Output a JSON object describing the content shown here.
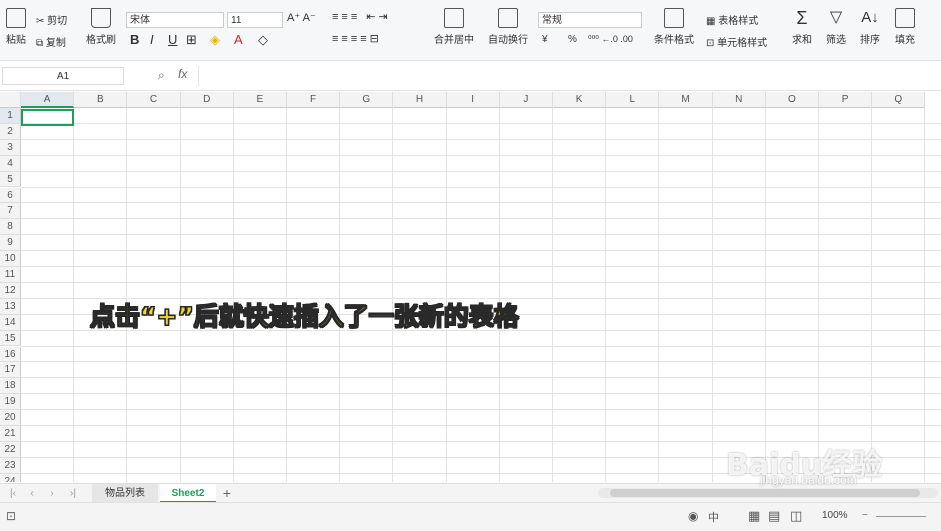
{
  "toolbar": {
    "paste": "粘贴",
    "cut": "剪切",
    "copy": "复制",
    "format_painter": "格式刷",
    "font_name": "宋体",
    "font_size": "11",
    "bold": "B",
    "italic": "I",
    "underline": "U",
    "merge_center": "合并居中",
    "wrap_text": "自动换行",
    "number_format": "常规",
    "currency": "¥",
    "percent": "%",
    "conditional_format": "条件格式",
    "table_style": "表格样式",
    "cell_style": "单元格样式",
    "sum": "求和",
    "filter": "筛选",
    "sort": "排序",
    "fill": "填充"
  },
  "formula_bar": {
    "cell_ref": "A1",
    "fx": "fx",
    "value": ""
  },
  "sheet": {
    "columns": [
      "A",
      "B",
      "C",
      "D",
      "E",
      "F",
      "G",
      "H",
      "I",
      "J",
      "K",
      "L",
      "M",
      "N",
      "O",
      "P",
      "Q"
    ],
    "rows": [
      "1",
      "2",
      "3",
      "4",
      "5",
      "6",
      "7",
      "8",
      "9",
      "10",
      "11",
      "12",
      "13",
      "14",
      "15",
      "16",
      "17",
      "18",
      "19",
      "20",
      "21",
      "22",
      "23",
      "24"
    ],
    "selected_cell": "A1"
  },
  "caption": "点击“+”后就快速插入了一张新的表格",
  "tabs": {
    "sheet1": "物品列表",
    "sheet2": "Sheet2",
    "add": "+"
  },
  "status": {
    "zoom": "100%",
    "input_mode": "中"
  },
  "watermark": {
    "brand": "Baidu经验",
    "url": "jingyan.baidu.com"
  },
  "colors": {
    "accent": "#1e9e5a",
    "caption": "#f5d42a"
  }
}
